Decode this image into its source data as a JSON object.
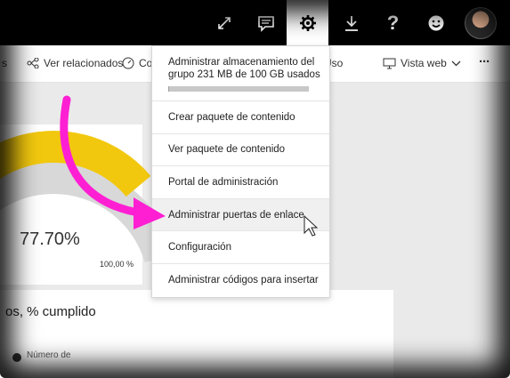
{
  "topbar": {
    "buttons": [
      {
        "name": "fullscreen",
        "icon": "expand-icon"
      },
      {
        "name": "comments",
        "icon": "comment-icon"
      },
      {
        "name": "settings",
        "icon": "gear-icon",
        "active": true
      },
      {
        "name": "download",
        "icon": "download-icon"
      },
      {
        "name": "help",
        "icon": "help-icon",
        "glyph": "?"
      },
      {
        "name": "feedback",
        "icon": "smiley-icon"
      }
    ]
  },
  "toolbar": {
    "left_partial": "s",
    "related_label": "Ver relacionados",
    "partial_label": "Co",
    "usage_label": "Uso",
    "web_view_label": "Vista web",
    "more_glyph": "···"
  },
  "settings_menu": {
    "storage_line1": "Administrar almacenamiento del",
    "storage_line2": "grupo 231 MB de 100 GB usados",
    "storage_used_fraction": 0.0023,
    "items": [
      {
        "label": "Crear paquete de contenido"
      },
      {
        "label": "Ver paquete de contenido"
      },
      {
        "label": "Portal de administración"
      },
      {
        "label": "Administrar puertas de enlace",
        "hovered": true
      },
      {
        "label": "Configuración"
      },
      {
        "label": "Administrar códigos para insertar"
      }
    ]
  },
  "dashboard": {
    "gauge_value": "77.70%",
    "gauge_max": "100,00 %",
    "gauge_color": "#f2c80f",
    "tile_title": "os, % cumplido",
    "legend_text": "Número de"
  },
  "colors": {
    "topbar_bg": "#000000",
    "arrow": "#ff1fd3"
  }
}
